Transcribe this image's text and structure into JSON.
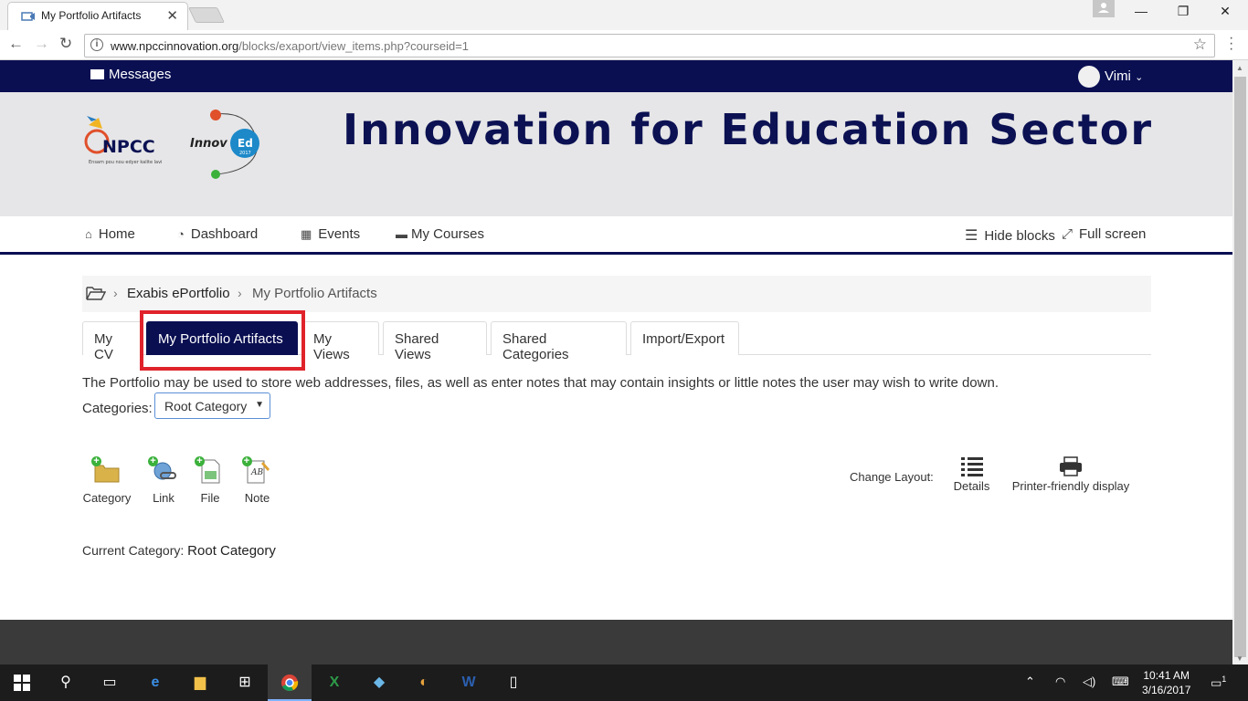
{
  "browser": {
    "tab_title": "My Portfolio Artifacts",
    "url_host": "www.npccinnovation.org",
    "url_path": "/blocks/exaport/view_items.php?courseid=1"
  },
  "topbar": {
    "messages": "Messages",
    "user_name": "Vimi"
  },
  "banner": {
    "headline": "Innovation for Education Sector",
    "logo_npcc": "NPCC",
    "logo_npcc_tagline": "Ensam pou nou edyer kalite lavi",
    "logo_innov": "Innov",
    "logo_innov_ed": "Ed",
    "logo_innov_year": "2017"
  },
  "nav": {
    "home": "Home",
    "dashboard": "Dashboard",
    "events": "Events",
    "courses": "My Courses",
    "hide_blocks": "Hide blocks",
    "full_screen": "Full screen"
  },
  "breadcrumb": {
    "items": [
      "Exabis ePortfolio",
      "My Portfolio Artifacts"
    ]
  },
  "tabs": [
    {
      "label": "My CV"
    },
    {
      "label": "My Portfolio Artifacts",
      "active": true
    },
    {
      "label": "My Views"
    },
    {
      "label": "Shared Views"
    },
    {
      "label": "Shared Categories"
    },
    {
      "label": "Import/Export"
    }
  ],
  "content": {
    "intro": "The Portfolio may be used to store web addresses, files, as well as enter notes that may contain insights or little notes the user may wish to write down.",
    "categories_label": "Categories:",
    "categories_selected": "Root Category",
    "tools": {
      "category": "Category",
      "link": "Link",
      "file": "File",
      "note": "Note"
    },
    "change_layout": "Change Layout:",
    "details": "Details",
    "printer": "Printer-friendly display",
    "current_category_label": "Current Category:",
    "current_category_value": "Root Category"
  },
  "taskbar": {
    "time": "10:41 AM",
    "date": "3/16/2017",
    "notifications": "1"
  },
  "colors": {
    "brand_navy": "#0a0f52",
    "highlight_red": "#e0232b",
    "banner_gray": "#e6e6e8"
  }
}
